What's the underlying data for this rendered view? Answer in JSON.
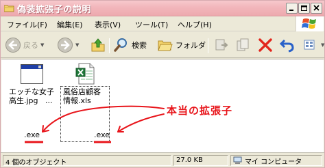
{
  "window": {
    "title": "偽装拡張子の説明"
  },
  "menu": {
    "items": [
      "ファイル(F)",
      "編集(E)",
      "表示(V)",
      "ツール(T)",
      "ヘルプ(H)"
    ]
  },
  "toolbar": {
    "back_label": "戻る",
    "search_label": "検索",
    "folders_label": "フォルダ"
  },
  "files": [
    {
      "name": "エッチな女子高生.jpg",
      "line1": "エッチな女子",
      "line2": "高生.jpg",
      "ellipsis": "...",
      "icon": "application-window-icon",
      "extension": ".exe"
    },
    {
      "name": "風俗店顧客情報.xls",
      "line1": "風俗店顧客",
      "line2": "情報.xls",
      "icon": "excel-document-icon",
      "extension": ".exe"
    }
  ],
  "annotation": {
    "text": "本当の拡張子",
    "color": "#e8141a"
  },
  "status": {
    "objects": "4 個のオブジェクト",
    "size": "27.0 KB",
    "location": "マイ コンピュータ"
  },
  "colors": {
    "titlebar": "#f2b6bb",
    "annotation": "#e8141a",
    "chrome": "#ece9d8"
  }
}
